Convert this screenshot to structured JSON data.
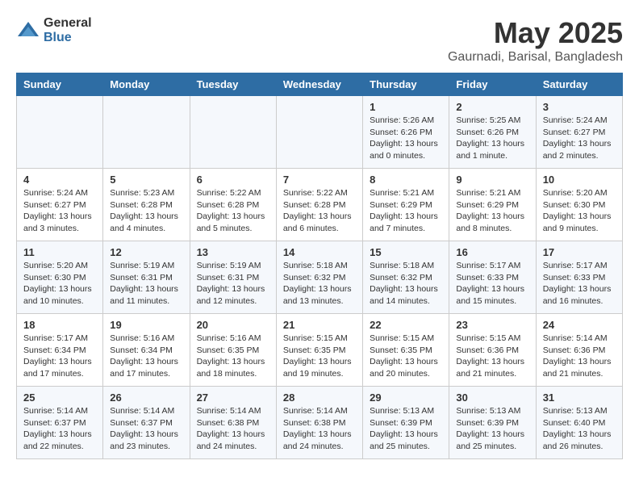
{
  "logo": {
    "general": "General",
    "blue": "Blue"
  },
  "header": {
    "title": "May 2025",
    "subtitle": "Gaurnadi, Barisal, Bangladesh"
  },
  "weekdays": [
    "Sunday",
    "Monday",
    "Tuesday",
    "Wednesday",
    "Thursday",
    "Friday",
    "Saturday"
  ],
  "weeks": [
    [
      {
        "day": "",
        "sunrise": "",
        "sunset": "",
        "daylight": ""
      },
      {
        "day": "",
        "sunrise": "",
        "sunset": "",
        "daylight": ""
      },
      {
        "day": "",
        "sunrise": "",
        "sunset": "",
        "daylight": ""
      },
      {
        "day": "",
        "sunrise": "",
        "sunset": "",
        "daylight": ""
      },
      {
        "day": "1",
        "sunrise": "5:26 AM",
        "sunset": "6:26 PM",
        "daylight": "13 hours and 0 minutes."
      },
      {
        "day": "2",
        "sunrise": "5:25 AM",
        "sunset": "6:26 PM",
        "daylight": "13 hours and 1 minute."
      },
      {
        "day": "3",
        "sunrise": "5:24 AM",
        "sunset": "6:27 PM",
        "daylight": "13 hours and 2 minutes."
      }
    ],
    [
      {
        "day": "4",
        "sunrise": "5:24 AM",
        "sunset": "6:27 PM",
        "daylight": "13 hours and 3 minutes."
      },
      {
        "day": "5",
        "sunrise": "5:23 AM",
        "sunset": "6:28 PM",
        "daylight": "13 hours and 4 minutes."
      },
      {
        "day": "6",
        "sunrise": "5:22 AM",
        "sunset": "6:28 PM",
        "daylight": "13 hours and 5 minutes."
      },
      {
        "day": "7",
        "sunrise": "5:22 AM",
        "sunset": "6:28 PM",
        "daylight": "13 hours and 6 minutes."
      },
      {
        "day": "8",
        "sunrise": "5:21 AM",
        "sunset": "6:29 PM",
        "daylight": "13 hours and 7 minutes."
      },
      {
        "day": "9",
        "sunrise": "5:21 AM",
        "sunset": "6:29 PM",
        "daylight": "13 hours and 8 minutes."
      },
      {
        "day": "10",
        "sunrise": "5:20 AM",
        "sunset": "6:30 PM",
        "daylight": "13 hours and 9 minutes."
      }
    ],
    [
      {
        "day": "11",
        "sunrise": "5:20 AM",
        "sunset": "6:30 PM",
        "daylight": "13 hours and 10 minutes."
      },
      {
        "day": "12",
        "sunrise": "5:19 AM",
        "sunset": "6:31 PM",
        "daylight": "13 hours and 11 minutes."
      },
      {
        "day": "13",
        "sunrise": "5:19 AM",
        "sunset": "6:31 PM",
        "daylight": "13 hours and 12 minutes."
      },
      {
        "day": "14",
        "sunrise": "5:18 AM",
        "sunset": "6:32 PM",
        "daylight": "13 hours and 13 minutes."
      },
      {
        "day": "15",
        "sunrise": "5:18 AM",
        "sunset": "6:32 PM",
        "daylight": "13 hours and 14 minutes."
      },
      {
        "day": "16",
        "sunrise": "5:17 AM",
        "sunset": "6:33 PM",
        "daylight": "13 hours and 15 minutes."
      },
      {
        "day": "17",
        "sunrise": "5:17 AM",
        "sunset": "6:33 PM",
        "daylight": "13 hours and 16 minutes."
      }
    ],
    [
      {
        "day": "18",
        "sunrise": "5:17 AM",
        "sunset": "6:34 PM",
        "daylight": "13 hours and 17 minutes."
      },
      {
        "day": "19",
        "sunrise": "5:16 AM",
        "sunset": "6:34 PM",
        "daylight": "13 hours and 17 minutes."
      },
      {
        "day": "20",
        "sunrise": "5:16 AM",
        "sunset": "6:35 PM",
        "daylight": "13 hours and 18 minutes."
      },
      {
        "day": "21",
        "sunrise": "5:15 AM",
        "sunset": "6:35 PM",
        "daylight": "13 hours and 19 minutes."
      },
      {
        "day": "22",
        "sunrise": "5:15 AM",
        "sunset": "6:35 PM",
        "daylight": "13 hours and 20 minutes."
      },
      {
        "day": "23",
        "sunrise": "5:15 AM",
        "sunset": "6:36 PM",
        "daylight": "13 hours and 21 minutes."
      },
      {
        "day": "24",
        "sunrise": "5:14 AM",
        "sunset": "6:36 PM",
        "daylight": "13 hours and 21 minutes."
      }
    ],
    [
      {
        "day": "25",
        "sunrise": "5:14 AM",
        "sunset": "6:37 PM",
        "daylight": "13 hours and 22 minutes."
      },
      {
        "day": "26",
        "sunrise": "5:14 AM",
        "sunset": "6:37 PM",
        "daylight": "13 hours and 23 minutes."
      },
      {
        "day": "27",
        "sunrise": "5:14 AM",
        "sunset": "6:38 PM",
        "daylight": "13 hours and 24 minutes."
      },
      {
        "day": "28",
        "sunrise": "5:14 AM",
        "sunset": "6:38 PM",
        "daylight": "13 hours and 24 minutes."
      },
      {
        "day": "29",
        "sunrise": "5:13 AM",
        "sunset": "6:39 PM",
        "daylight": "13 hours and 25 minutes."
      },
      {
        "day": "30",
        "sunrise": "5:13 AM",
        "sunset": "6:39 PM",
        "daylight": "13 hours and 25 minutes."
      },
      {
        "day": "31",
        "sunrise": "5:13 AM",
        "sunset": "6:40 PM",
        "daylight": "13 hours and 26 minutes."
      }
    ]
  ],
  "labels": {
    "sunrise_prefix": "Sunrise: ",
    "sunset_prefix": "Sunset: ",
    "daylight_prefix": "Daylight: "
  }
}
